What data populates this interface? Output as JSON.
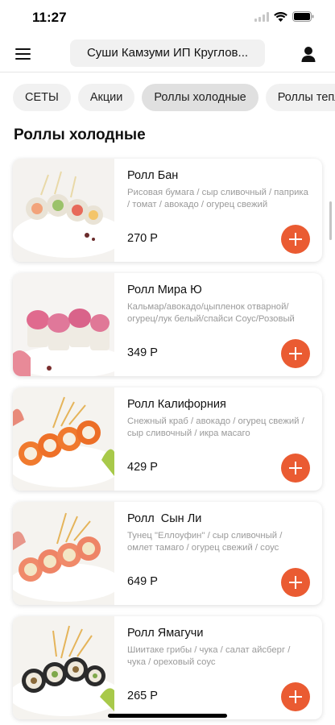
{
  "status": {
    "time": "11:27"
  },
  "header": {
    "title": "Суши Камзуми ИП Круглов..."
  },
  "tabs": [
    {
      "label": "СЕТЫ",
      "active": false
    },
    {
      "label": "Акции",
      "active": false
    },
    {
      "label": "Роллы холодные",
      "active": true
    },
    {
      "label": "Роллы теплые",
      "active": false
    }
  ],
  "section": {
    "title": "Роллы холодные"
  },
  "products": [
    {
      "name": "Ролл Бан",
      "description": "Рисовая бумага / сыр сливочный / паприка / томат / авокадо / огурец свежий",
      "price": "270 Р",
      "image": "rice-paper-rolls"
    },
    {
      "name": "Ролл Мира Ю",
      "description": "Кальмар/авокадо/цыпленок отварной/ огурец/лук белый/спайси Соус/Розовый тобико",
      "price": "349 Р",
      "image": "pink-topped-rolls"
    },
    {
      "name": "Ролл Калифорния",
      "description": "Снежный краб / авокадо / огурец свежий /сыр сливочный / икра масаго",
      "price": "429 Р",
      "image": "california-rolls"
    },
    {
      "name": "Ролл  Сын Ли",
      "description": "Тунец \"Еллоуфин\" / сыр сливочный / омлет тамаго / огурец свежий / соус спайси",
      "price": "649 Р",
      "image": "tuna-rolls"
    },
    {
      "name": "Ролл Ямагучи",
      "description": "Шиитаке грибы / чука / салат айсберг / чука / ореховый соус",
      "price": "265 Р",
      "image": "nori-rolls"
    }
  ],
  "colors": {
    "accent": "#ea5b32",
    "muted_text": "#9a9a9a",
    "pill_bg": "#f1f1f1"
  }
}
